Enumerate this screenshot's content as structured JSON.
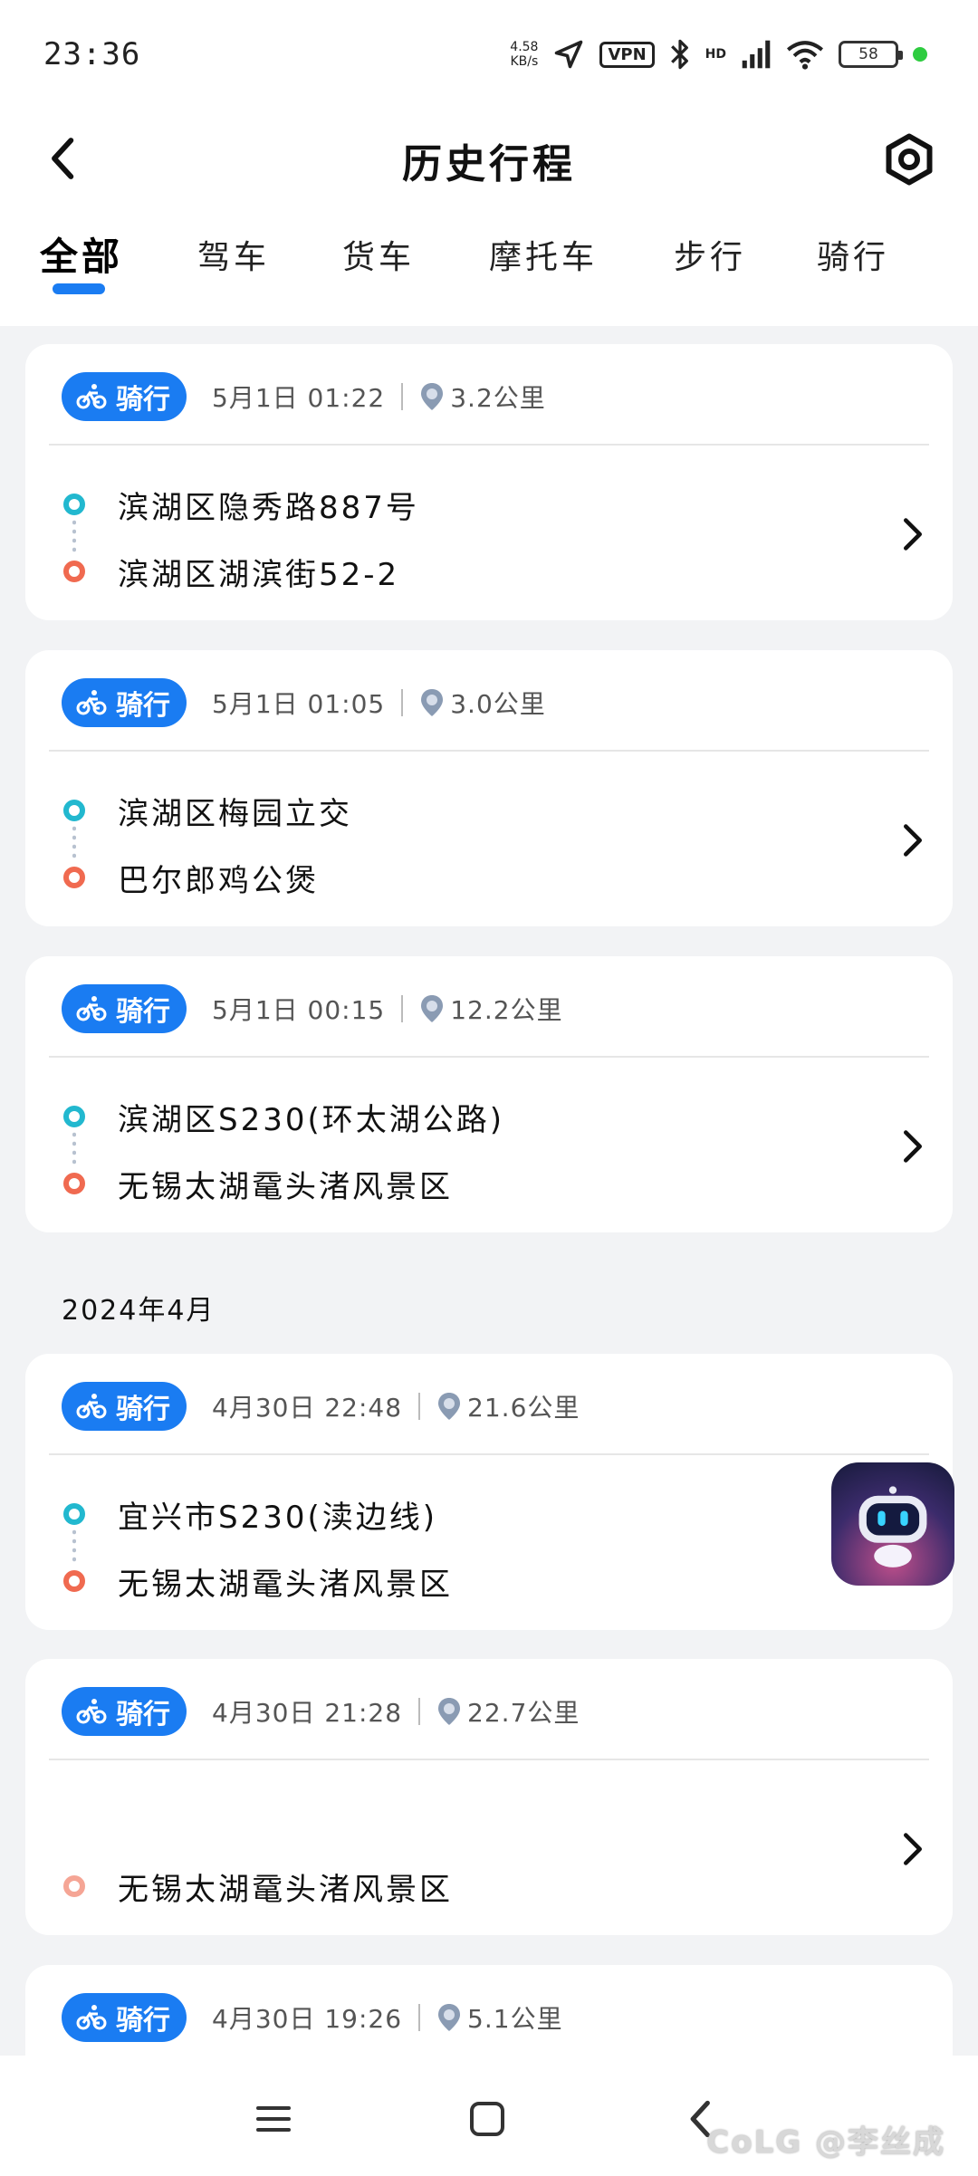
{
  "status_bar": {
    "time": "23:36",
    "net_speed_value": "4.58",
    "net_speed_unit": "KB/s",
    "vpn": "VPN",
    "hd": "HD",
    "battery": "58"
  },
  "header": {
    "title": "历史行程"
  },
  "tabs": [
    {
      "label": "全部",
      "active": true
    },
    {
      "label": "驾车",
      "active": false
    },
    {
      "label": "货车",
      "active": false
    },
    {
      "label": "摩托车",
      "active": false
    },
    {
      "label": "步行",
      "active": false
    },
    {
      "label": "骑行",
      "active": false
    }
  ],
  "month_label": "2024年4月",
  "trips": [
    {
      "mode": "骑行",
      "time": "5月1日 01:22",
      "distance": "3.2公里",
      "start": "滨湖区隐秀路887号",
      "end": "滨湖区湖滨街52-2"
    },
    {
      "mode": "骑行",
      "time": "5月1日 01:05",
      "distance": "3.0公里",
      "start": "滨湖区梅园立交",
      "end": "巴尔郎鸡公煲"
    },
    {
      "mode": "骑行",
      "time": "5月1日 00:15",
      "distance": "12.2公里",
      "start": "滨湖区S230(环太湖公路)",
      "end": "无锡太湖鼋头渚风景区"
    },
    {
      "mode": "骑行",
      "time": "4月30日 22:48",
      "distance": "21.6公里",
      "start": "宜兴市S230(渎边线)",
      "end": "无锡太湖鼋头渚风景区"
    },
    {
      "mode": "骑行",
      "time": "4月30日 21:28",
      "distance": "22.7公里",
      "start": "",
      "end": "无锡太湖鼋头渚风景区"
    },
    {
      "mode": "骑行",
      "time": "4月30日 19:26",
      "distance": "5.1公里"
    }
  ],
  "watermark": "CoLG @李丝成",
  "colors": {
    "accent": "#1a7cf2",
    "start_dot": "#22b8cf",
    "end_dot": "#f06a50"
  }
}
